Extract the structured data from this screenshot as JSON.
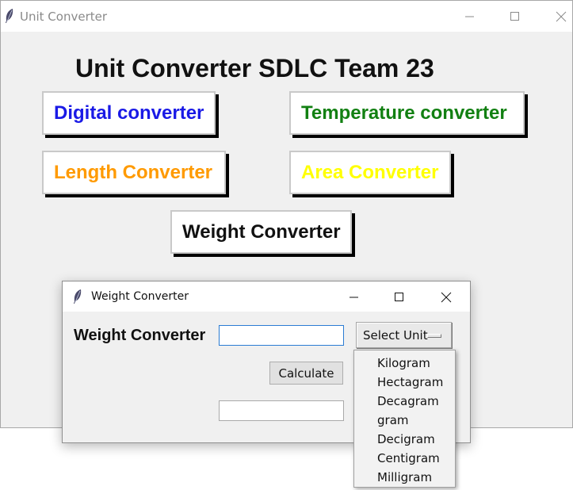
{
  "main_window": {
    "title": "Unit Converter",
    "heading": "Unit Converter SDLC Team 23",
    "buttons": {
      "digital": {
        "label": "Digital converter",
        "color": "#1a1ae6"
      },
      "temperature": {
        "label": "Temperature converter",
        "color": "#128012"
      },
      "length": {
        "label": "Length Converter",
        "color": "#ff9a00"
      },
      "area": {
        "label": "Area Converter",
        "color": "#ffff00"
      },
      "weight": {
        "label": "Weight Converter",
        "color": "#111111"
      }
    }
  },
  "dialog": {
    "title": "Weight Converter",
    "label": "Weight Converter",
    "input_value": "",
    "select_label": "Select Unit",
    "calculate_label": "Calculate",
    "output_value": ""
  },
  "dropdown": {
    "options": [
      "Kilogram",
      "Hectagram",
      "Decagram",
      "gram",
      "Decigram",
      "Centigram",
      "Milligram"
    ]
  },
  "icons": {
    "app": "feather-icon",
    "minimize": "minimize-icon",
    "maximize": "maximize-icon",
    "close": "close-icon"
  }
}
